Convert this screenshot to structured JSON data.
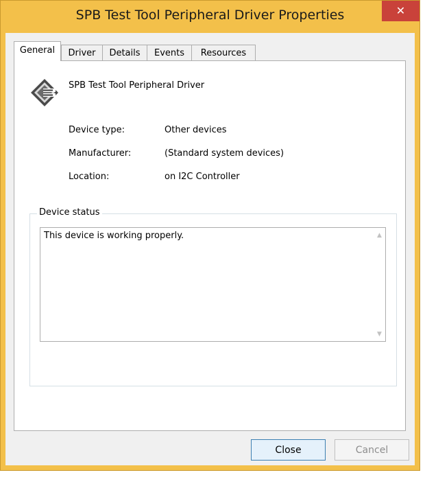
{
  "window": {
    "title": "SPB Test Tool Peripheral Driver Properties",
    "close_glyph": "✕",
    "accent_color": "#f3c04a",
    "close_color": "#c9423a"
  },
  "tabs": [
    {
      "label": "General",
      "active": true
    },
    {
      "label": "Driver",
      "active": false
    },
    {
      "label": "Details",
      "active": false
    },
    {
      "label": "Events",
      "active": false
    },
    {
      "label": "Resources",
      "active": false
    }
  ],
  "general": {
    "device_icon": "device-driver-icon",
    "device_name": "SPB Test Tool Peripheral Driver",
    "properties": [
      {
        "label": "Device type:",
        "value": "Other devices"
      },
      {
        "label": "Manufacturer:",
        "value": "(Standard system devices)"
      },
      {
        "label": "Location:",
        "value": "on I2C Controller"
      }
    ],
    "status_group_title": "Device status",
    "status_text": "This device is working properly."
  },
  "buttons": {
    "close_label": "Close",
    "cancel_label": "Cancel",
    "cancel_enabled": false
  }
}
